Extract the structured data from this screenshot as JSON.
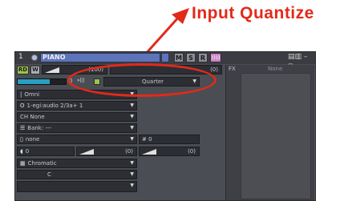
{
  "annotation": {
    "label": "Input Quantize",
    "color": "#e22a1a"
  },
  "titlebar": {
    "track_number": "1",
    "track_name": "PIANO",
    "m_label": "M",
    "s_label": "S",
    "r_label": "R",
    "monitor_label": "))))",
    "window_icons": "▤▥ – ▫"
  },
  "top_controls": {
    "rd_label": "RD",
    "w_label": "W",
    "volume_readout": "(100)",
    "pan_readout": "(0)",
    "meter_value": "0",
    "input_quantize_icon": "»|||",
    "input_quantize_value": "Quarter"
  },
  "settings": {
    "omni": "Omni",
    "port": "1-egi:audio 2/3a+ 1",
    "channel": "CH None",
    "bank": "Bank: ---",
    "patch": "none",
    "patch_num_prefix": "#",
    "patch_num_value": "0",
    "key_offset": "0",
    "vel_readout": "(0)",
    "pan2_readout": "(0)",
    "scale": "Chromatic",
    "key": "C"
  },
  "fx": {
    "label": "FX",
    "none_label": "None"
  },
  "colors": {
    "accent": "#5d74b8",
    "panel": "#4a4d53",
    "meter": "#29a0c4",
    "green": "#9cc44d"
  }
}
